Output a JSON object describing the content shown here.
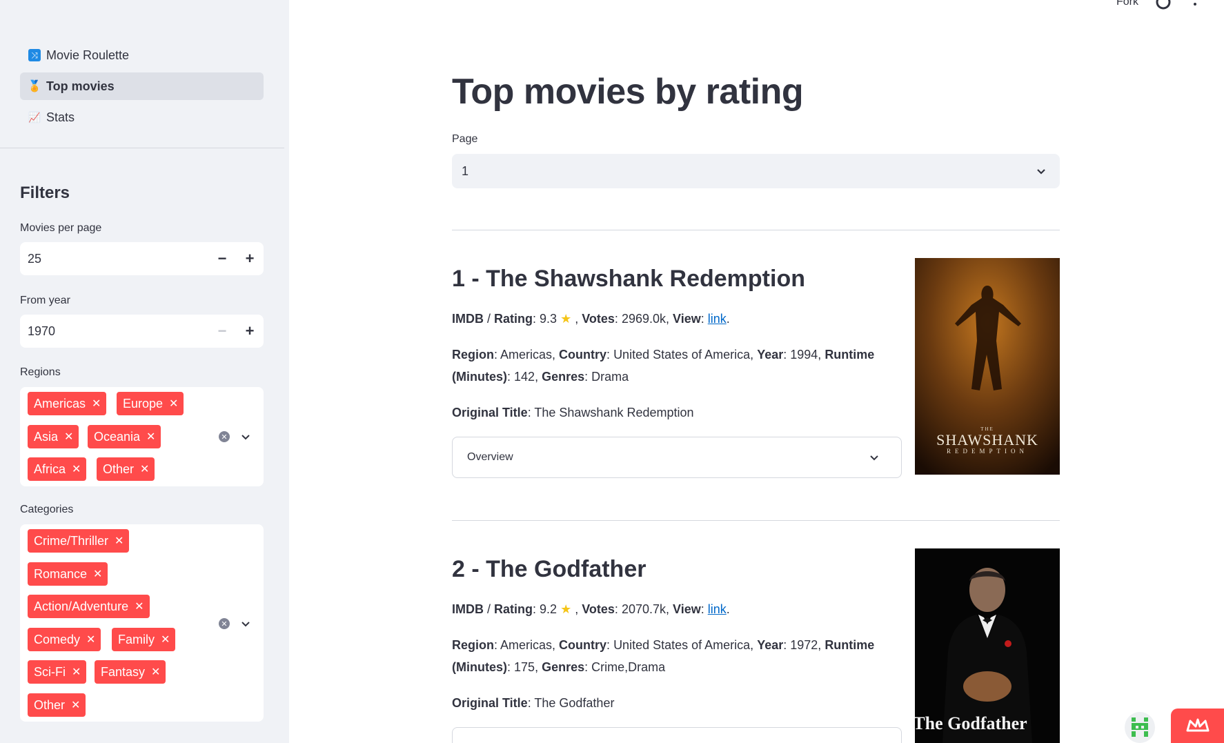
{
  "toolbar": {
    "fork_label": "Fork"
  },
  "nav": {
    "items": [
      {
        "label": "Movie Roulette",
        "icon": "shuffle-icon"
      },
      {
        "label": "Top movies",
        "icon": "medal-icon",
        "active": true
      },
      {
        "label": "Stats",
        "icon": "chart-icon"
      }
    ]
  },
  "filters": {
    "title": "Filters",
    "movies_per_page": {
      "label": "Movies per page",
      "value": "25"
    },
    "from_year": {
      "label": "From year",
      "value": "1970"
    },
    "regions": {
      "label": "Regions",
      "tags": [
        "Americas",
        "Europe",
        "Asia",
        "Oceania",
        "Africa",
        "Other"
      ]
    },
    "categories": {
      "label": "Categories",
      "tags": [
        "Crime/Thriller",
        "Romance",
        "Action/Adventure",
        "Comedy",
        "Family",
        "Sci-Fi",
        "Fantasy",
        "Other"
      ]
    }
  },
  "main": {
    "title": "Top movies by rating",
    "page_label": "Page",
    "page_value": "1",
    "movies": [
      {
        "heading": "1 - The Shawshank Redemption",
        "source": "IMDB",
        "rating": "9.3",
        "votes": "2969.0k",
        "link_text": "link",
        "region": "Americas",
        "country": "United States of America",
        "year": "1994",
        "runtime": "142",
        "genres": "Drama",
        "original_title": "The Shawshank Redemption",
        "overview_label": "Overview",
        "poster_text": "SHAWSHANK",
        "poster_sub": "REDEMPTION",
        "poster_the": "THE"
      },
      {
        "heading": "2 - The Godfather",
        "source": "IMDB",
        "rating": "9.2",
        "votes": "2070.7k",
        "link_text": "link",
        "region": "Americas",
        "country": "United States of America",
        "year": "1972",
        "runtime": "175",
        "genres": "Crime,Drama",
        "original_title": "The Godfather",
        "poster_text": "The Godfather"
      }
    ]
  },
  "labels": {
    "rating": "Rating",
    "votes": "Votes",
    "view": "View",
    "region": "Region",
    "country": "Country",
    "year": "Year",
    "runtime": "Runtime",
    "minutes": "(Minutes)",
    "genres": "Genres",
    "original_title": "Original Title"
  },
  "colors": {
    "accent": "#ff4b4b",
    "link": "#0068c9",
    "sidebar_bg": "#f0f2f6"
  }
}
